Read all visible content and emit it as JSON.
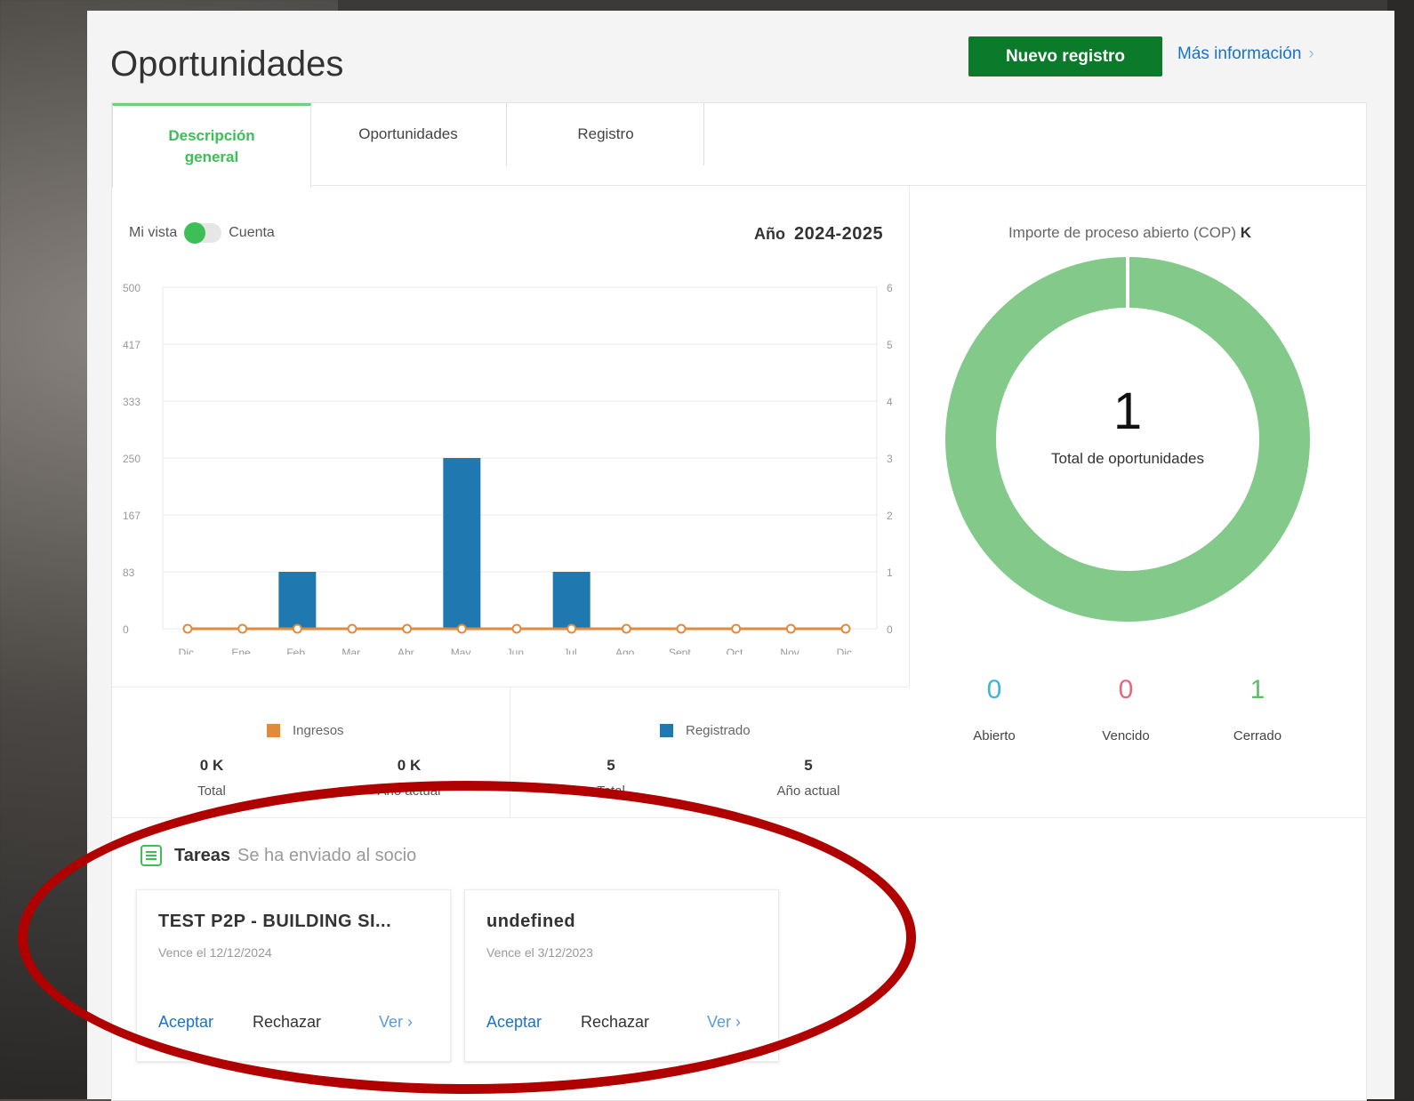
{
  "page": {
    "title": "Oportunidades",
    "new_button": "Nuevo registro",
    "more_info": "Más información"
  },
  "tabs": [
    {
      "label_line1": "Descripción",
      "label_line2": "general",
      "active": true
    },
    {
      "label": "Oportunidades",
      "active": false
    },
    {
      "label": "Registro",
      "active": false
    }
  ],
  "view_toggle": {
    "left_label": "Mi vista",
    "right_label": "Cuenta",
    "state": "on"
  },
  "year": {
    "label": "Año",
    "value": "2024-2025"
  },
  "chart_data": {
    "type": "bar",
    "categories": [
      "Dic.",
      "Ene.",
      "Feb.",
      "Mar.",
      "Abr.",
      "May.",
      "Jun.",
      "Jul.",
      "Ago.",
      "Sept.",
      "Oct.",
      "Nov.",
      "Dic."
    ],
    "series": [
      {
        "name": "Registrado",
        "type": "bar",
        "axis": "right",
        "color": "#1f78b0",
        "values": [
          0,
          0,
          1,
          0,
          0,
          3,
          0,
          1,
          0,
          0,
          0,
          0,
          0
        ]
      },
      {
        "name": "Ingresos",
        "type": "line",
        "axis": "left",
        "color": "#e28a3c",
        "values": [
          0,
          0,
          0,
          0,
          0,
          0,
          0,
          0,
          0,
          0,
          0,
          0,
          0
        ]
      }
    ],
    "y_left_ticks": [
      "500",
      "417",
      "333",
      "250",
      "167",
      "83",
      "0"
    ],
    "y_right_ticks": [
      "6",
      "5",
      "4",
      "3",
      "2",
      "1",
      "0"
    ],
    "ylim_left": [
      0,
      500
    ],
    "ylim_right": [
      0,
      6
    ],
    "grid": true
  },
  "legend": {
    "ingresos": {
      "name": "Ingresos",
      "color": "#e28a3c",
      "total": "0 K",
      "total_label": "Total",
      "year": "0 K",
      "year_label": "Año actual"
    },
    "registrado": {
      "name": "Registrado",
      "color": "#1f78b0",
      "total": "5",
      "total_label": "Total",
      "year": "5",
      "year_label": "Año actual"
    }
  },
  "donut": {
    "title": "Importe de proceso abierto (COP)",
    "unit": "K",
    "count": "1",
    "caption": "Total de oportunidades",
    "color": "#82c98a"
  },
  "status_counts": [
    {
      "value": "0",
      "label": "Abierto",
      "color": "#3fb3d9"
    },
    {
      "value": "0",
      "label": "Vencido",
      "color": "#e06a80"
    },
    {
      "value": "1",
      "label": "Cerrado",
      "color": "#5cbf64"
    }
  ],
  "tasks": {
    "title": "Tareas",
    "subtitle": "Se ha enviado al socio",
    "items": [
      {
        "title": "TEST P2P - BUILDING SI...",
        "due": "Vence el 12/12/2024",
        "accept": "Aceptar",
        "reject": "Rechazar",
        "view": "Ver"
      },
      {
        "title": "undefined",
        "due": "Vence el 3/12/2023",
        "accept": "Aceptar",
        "reject": "Rechazar",
        "view": "Ver"
      }
    ]
  }
}
